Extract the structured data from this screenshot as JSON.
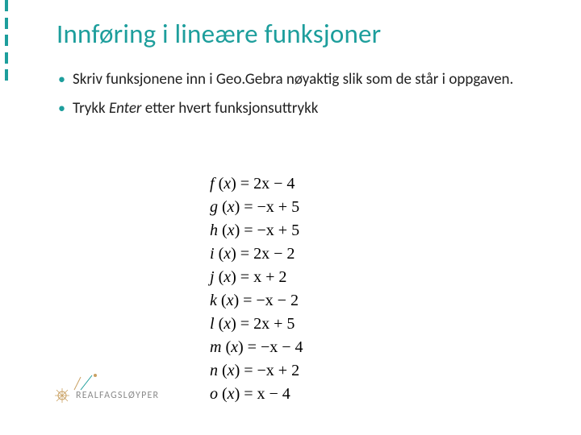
{
  "title": "Innføring i lineære funksjoner",
  "bullets": [
    {
      "pre": "Skriv  funksjonene inn i Geo.Gebra nøyaktig slik som de står i oppgaven."
    },
    {
      "pre": "Trykk ",
      "em": "Enter",
      "post": " etter hvert funksjonsuttrykk"
    }
  ],
  "equations": [
    {
      "fn": "f",
      "rhs": "2x − 4"
    },
    {
      "fn": "g",
      "rhs": "−x + 5"
    },
    {
      "fn": "h",
      "rhs": "−x + 5"
    },
    {
      "fn": "i",
      "rhs": "2x − 2"
    },
    {
      "fn": "j",
      "rhs": "x + 2"
    },
    {
      "fn": "k",
      "rhs": "−x − 2"
    },
    {
      "fn": "l",
      "rhs": "2x + 5"
    },
    {
      "fn": "m",
      "rhs": "−x − 4"
    },
    {
      "fn": "n",
      "rhs": "−x + 2"
    },
    {
      "fn": "o",
      "rhs": "x − 4"
    }
  ],
  "logo": {
    "text": "REALFAGSLØYPER"
  },
  "colors": {
    "accent": "#1d9e9c"
  }
}
